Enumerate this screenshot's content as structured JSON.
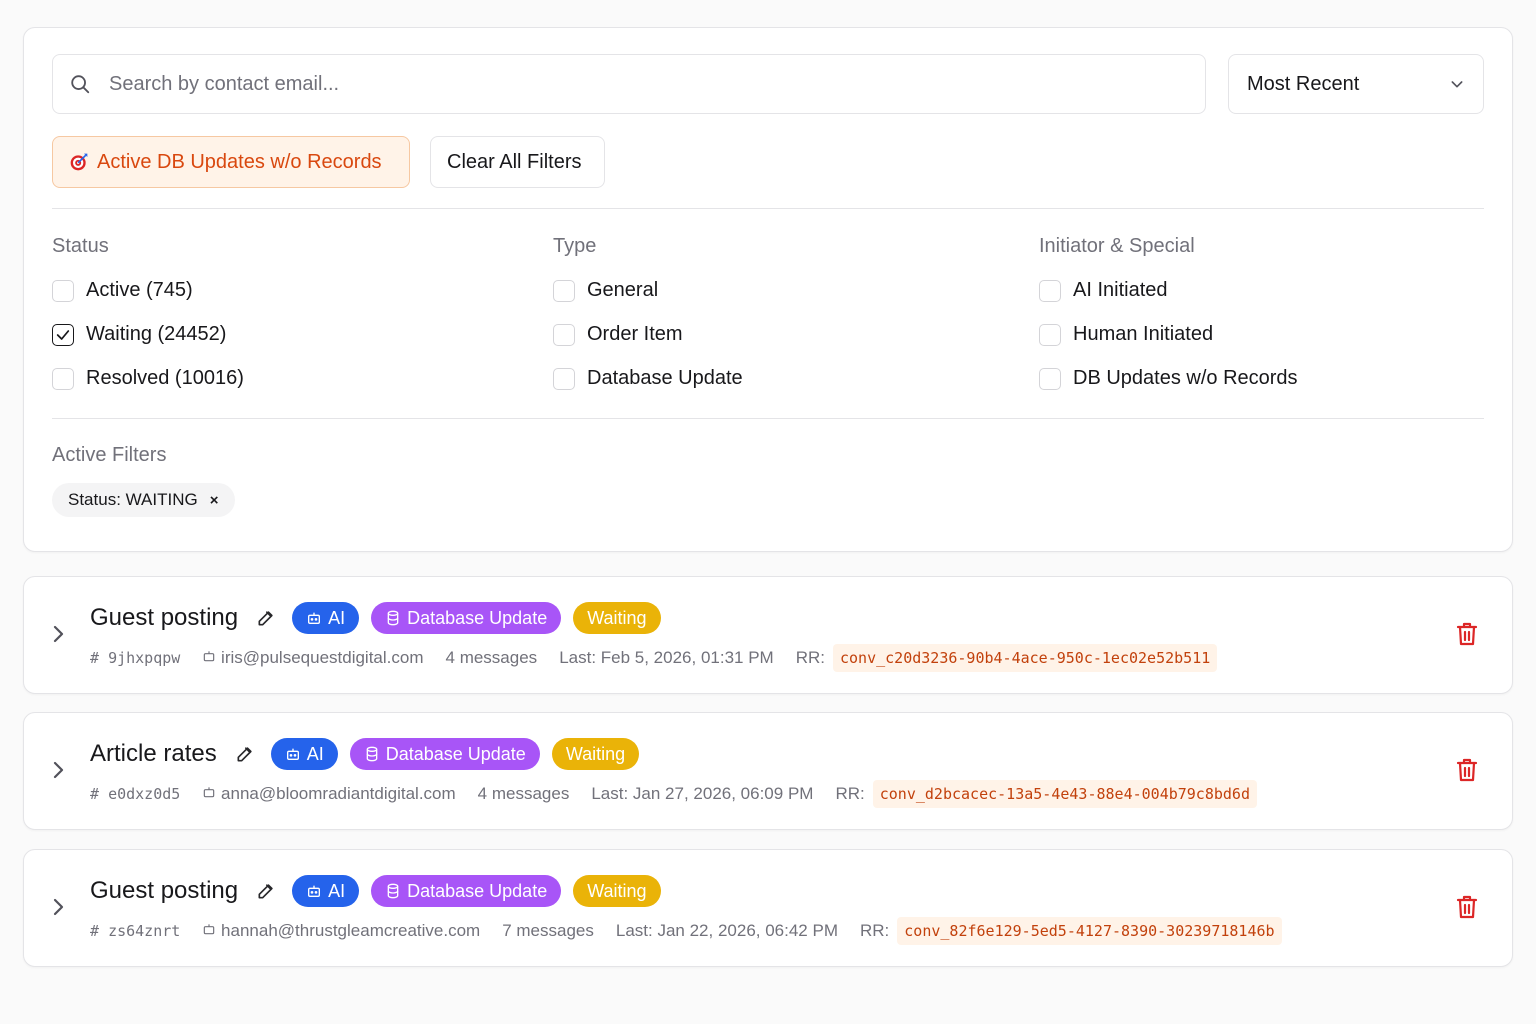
{
  "search": {
    "placeholder": "Search by contact email..."
  },
  "sort": {
    "selected": "Most Recent"
  },
  "quick_filters": {
    "active_db_updates": "Active DB Updates w/o Records",
    "clear_all": "Clear All Filters"
  },
  "filters": {
    "status": {
      "title": "Status",
      "options": [
        {
          "label": "Active (745)",
          "checked": false
        },
        {
          "label": "Waiting (24452)",
          "checked": true
        },
        {
          "label": "Resolved (10016)",
          "checked": false
        }
      ]
    },
    "type": {
      "title": "Type",
      "options": [
        {
          "label": "General",
          "checked": false
        },
        {
          "label": "Order Item",
          "checked": false
        },
        {
          "label": "Database Update",
          "checked": false
        }
      ]
    },
    "initiator": {
      "title": "Initiator & Special",
      "options": [
        {
          "label": "AI Initiated",
          "checked": false
        },
        {
          "label": "Human Initiated",
          "checked": false
        },
        {
          "label": "DB Updates w/o Records",
          "checked": false
        }
      ]
    }
  },
  "active_filters": {
    "title": "Active Filters",
    "chips": [
      {
        "label": "Status: WAITING",
        "remove": "×"
      }
    ]
  },
  "conversations": [
    {
      "title": "Guest posting",
      "badges": {
        "ai": "AI",
        "type": "Database Update",
        "status": "Waiting"
      },
      "id": "9jhxpqpw",
      "email": "iris@pulsequestdigital.com",
      "messages": "4 messages",
      "last": "Last: Feb 5, 2026, 01:31 PM",
      "rr_label": "RR:",
      "rr": "conv_c20d3236-90b4-4ace-950c-1ec02e52b511"
    },
    {
      "title": "Article rates",
      "badges": {
        "ai": "AI",
        "type": "Database Update",
        "status": "Waiting"
      },
      "id": "e0dxz0d5",
      "email": "anna@bloomradiantdigital.com",
      "messages": "4 messages",
      "last": "Last: Jan 27, 2026, 06:09 PM",
      "rr_label": "RR:",
      "rr": "conv_d2bcacec-13a5-4e43-88e4-004b79c8bd6d"
    },
    {
      "title": "Guest posting",
      "badges": {
        "ai": "AI",
        "type": "Database Update",
        "status": "Waiting"
      },
      "id": "zs64znrt",
      "email": "hannah@thrustgleamcreative.com",
      "messages": "7 messages",
      "last": "Last: Jan 22, 2026, 06:42 PM",
      "rr_label": "RR:",
      "rr": "conv_82f6e129-5ed5-4127-8390-30239718146b"
    }
  ],
  "colors": {
    "ai_badge": "#2563eb",
    "db_badge": "#a855f7",
    "waiting_badge": "#eab308",
    "delete": "#dc2626",
    "rr_text": "#c2410c"
  }
}
